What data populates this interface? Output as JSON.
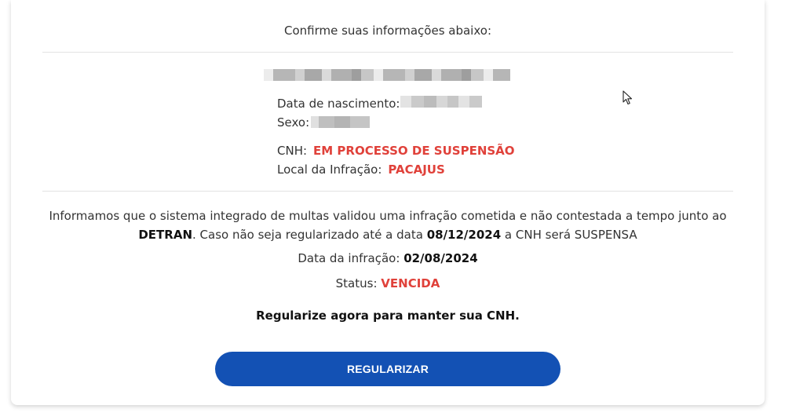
{
  "header": {
    "title": "Confirme suas informações abaixo:"
  },
  "person": {
    "dob_label": "Data de nascimento:",
    "sex_label": "Sexo:",
    "cnh_label": "CNH:",
    "cnh_value": "EM PROCESSO DE SUSPENSÃO",
    "local_label": "Local da Infração:",
    "local_value": "PACAJUS"
  },
  "notice": {
    "part1": "Informamos que o sistema integrado de multas validou uma infração cometida e não contestada a tempo junto ao ",
    "detran": "DETRAN",
    "part2": ". Caso não seja regularizado até a data ",
    "deadline": "08/12/2024",
    "part3": " a CNH será SUSPENSA"
  },
  "infraction": {
    "date_label": "Data da infração:",
    "date_value": "02/08/2024",
    "status_label": "Status:",
    "status_value": "VENCIDA"
  },
  "cta": {
    "text": "Regularize agora para manter sua CNH.",
    "button_label": "REGULARIZAR"
  },
  "colors": {
    "accent_red": "#e0413a",
    "button_blue": "#1351b4"
  },
  "icons": {
    "cursor": "mouse-pointer-icon"
  }
}
